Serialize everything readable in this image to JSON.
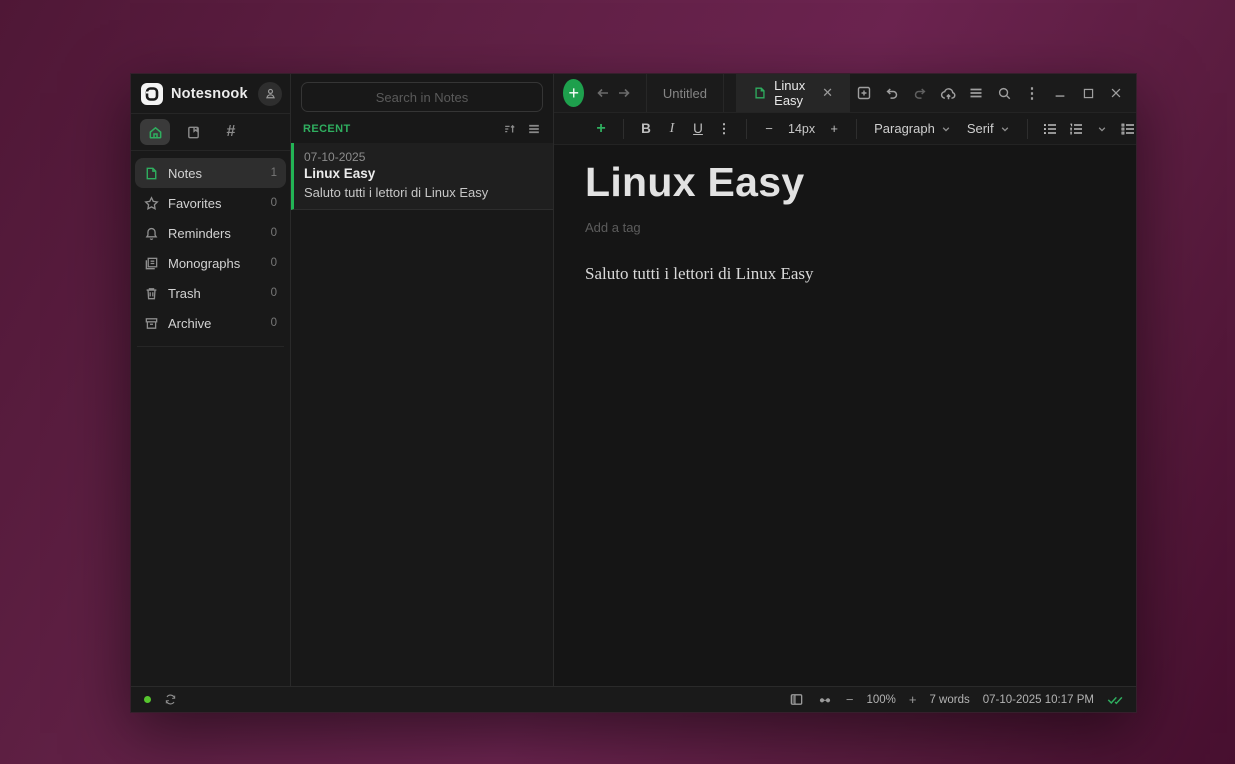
{
  "app": {
    "title": "Notesnook"
  },
  "colors": {
    "accent": "#2fae5f",
    "selected_bg": "#2e2e2e",
    "desktop_plum": "#6c2450"
  },
  "glyphs": {
    "plus": "+",
    "minus": "−",
    "close": "✕",
    "hash": "#",
    "kebab": "⋮"
  },
  "sidebar": {
    "nav_items": [
      {
        "label": "Notes",
        "count": "1"
      },
      {
        "label": "Favorites",
        "count": "0"
      },
      {
        "label": "Reminders",
        "count": "0"
      },
      {
        "label": "Monographs",
        "count": "0"
      },
      {
        "label": "Trash",
        "count": "0"
      },
      {
        "label": "Archive",
        "count": "0"
      }
    ]
  },
  "list_panel": {
    "search_placeholder": "Search in Notes",
    "section_label": "RECENT",
    "notes": [
      {
        "date": "07-10-2025",
        "title": "Linux Easy",
        "preview": "Saluto tutti i lettori di Linux Easy"
      }
    ]
  },
  "editor": {
    "tabs": [
      {
        "label": "Untitled"
      },
      {
        "label": "Linux Easy"
      }
    ],
    "toolbar": {
      "bold_label": "B",
      "italic_label": "I",
      "underline_label": "U",
      "font_size": "14px",
      "block_type": "Paragraph",
      "font_name": "Serif"
    },
    "note": {
      "title": "Linux Easy",
      "tag_placeholder": "Add a tag",
      "body": "Saluto tutti i lettori di Linux Easy"
    }
  },
  "status_bar": {
    "zoom_level": "100%",
    "word_count": "7 words",
    "timestamp": "07-10-2025 10:17 PM"
  }
}
